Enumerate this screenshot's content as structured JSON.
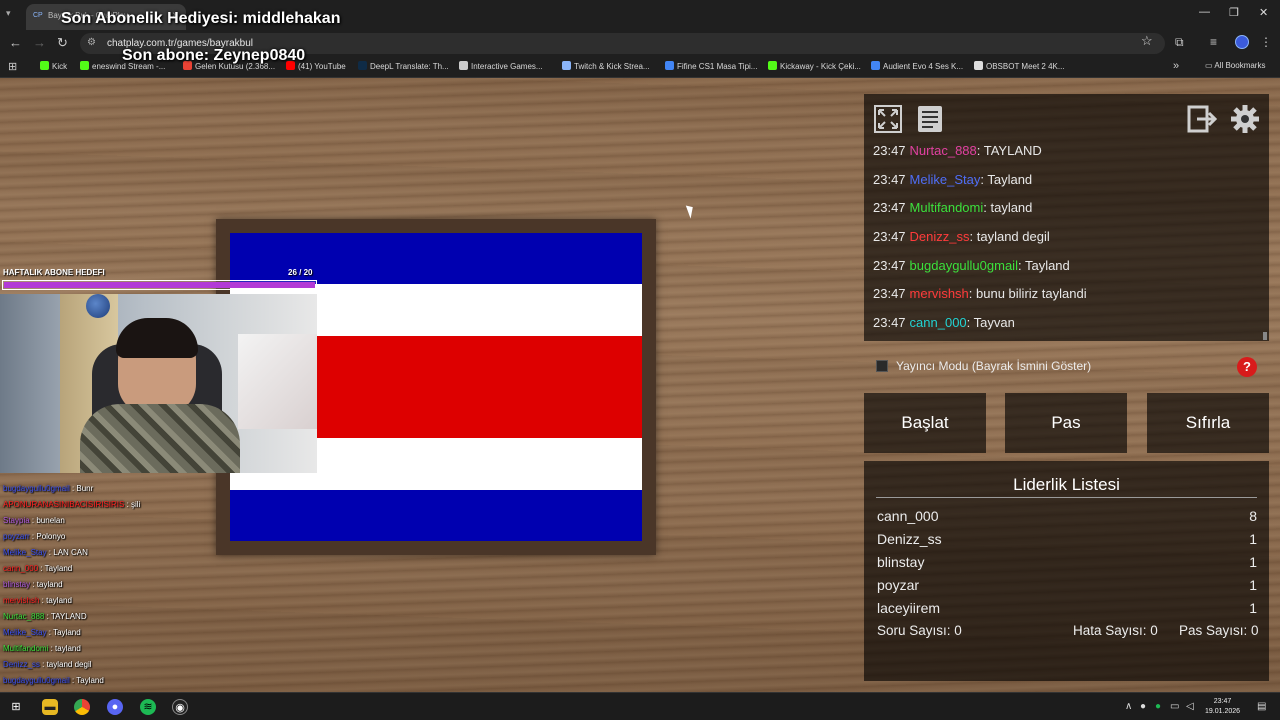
{
  "browser": {
    "tab_title": "Bayrak Bul – ChatPlay",
    "url": "chatplay.com.tr/games/bayrakbul",
    "bookmarks": [
      {
        "label": "Kick",
        "color": "#53fc18"
      },
      {
        "label": "eneswind Stream -...",
        "color": "#53fc18"
      },
      {
        "label": "Gelen Kutusu (2.368...",
        "color": "#ea4335"
      },
      {
        "label": "(41) YouTube",
        "color": "#ff0000"
      },
      {
        "label": "DeepL Translate: Th...",
        "color": "#0f2b46"
      },
      {
        "label": "Interactive Games...",
        "color": "#cccccc"
      },
      {
        "label": "Twitch & Kick Strea...",
        "color": "#8ab4f8"
      },
      {
        "label": "Fifine CS1 Masa Tipi...",
        "color": "#4285f4"
      },
      {
        "label": "Kickaway - Kick Çeki...",
        "color": "#53fc18"
      },
      {
        "label": "Audient Evo 4 Ses K...",
        "color": "#4285f4"
      },
      {
        "label": "OBSBOT Meet 2 4K...",
        "color": "#dddddd"
      }
    ],
    "all_bookmarks": "All Bookmarks"
  },
  "overlay": {
    "latest_gift": "Son Abonelik Hediyesi: middlehakan",
    "latest_sub": "Son abone: Zeynep0840",
    "goal_label": "HAFTALIK ABONE HEDEFI",
    "goal_count": "26  / 20",
    "goal_progress": 1.0
  },
  "game": {
    "flag_stripes": [
      {
        "color": "#0000b0",
        "weight": 1
      },
      {
        "color": "#ffffff",
        "weight": 1
      },
      {
        "color": "#dd0000",
        "weight": 2
      },
      {
        "color": "#ffffff",
        "weight": 1
      },
      {
        "color": "#0000b0",
        "weight": 1
      }
    ],
    "chat": [
      {
        "time": "23:47",
        "user": "Nurtac_888",
        "color": "#e040a0",
        "message": ": TAYLAND"
      },
      {
        "time": "23:47",
        "user": "Melike_Stay",
        "color": "#4f6ef7",
        "message": ": Tayland"
      },
      {
        "time": "23:47",
        "user": "Multifandomi",
        "color": "#3ce03c",
        "message": ": tayland"
      },
      {
        "time": "23:47",
        "user": "Denizz_ss",
        "color": "#ff3b3b",
        "message": ": tayland degil"
      },
      {
        "time": "23:47",
        "user": "bugdaygullu0gmail",
        "color": "#3ce03c",
        "message": ": Tayland"
      },
      {
        "time": "23:47",
        "user": "mervishsh",
        "color": "#ff3b3b",
        "message": ": bunu biliriz taylandi"
      },
      {
        "time": "23:47",
        "user": "cann_000",
        "color": "#22d3d3",
        "message": ": Tayvan"
      }
    ],
    "streamer_mode_label": "Yayıncı Modu (Bayrak İsmini Göster)",
    "help_label": "?",
    "buttons": {
      "start": "Başlat",
      "pass": "Pas",
      "reset": "Sıfırla"
    },
    "leaderboard_title": "Liderlik Listesi",
    "leaderboard": [
      {
        "name": "cann_000",
        "score": "8"
      },
      {
        "name": "Denizz_ss",
        "score": "1"
      },
      {
        "name": "blinstay",
        "score": "1"
      },
      {
        "name": "poyzar",
        "score": "1"
      },
      {
        "name": "laceyiirem",
        "score": "1"
      }
    ],
    "stats": {
      "questions": "Soru Sayısı: 0",
      "errors": "Hata Sayısı: 0",
      "passes": "Pas Sayısı: 0"
    }
  },
  "stream_chat": [
    {
      "user": "bugdaygullu0gmail",
      "color": "#3a4ff0",
      "message": " : Bunr"
    },
    {
      "user": "APONURANASINIBACISIRISIRIS",
      "color": "#ff2020",
      "message": " : şili"
    },
    {
      "user": "Staypia",
      "color": "#b05be0",
      "message": " : bunelan"
    },
    {
      "user": "poyzarr",
      "color": "#3a4ff0",
      "message": " : Polonyo"
    },
    {
      "user": "Melike_Stay",
      "color": "#3a4ff0",
      "message": " : LAN CAN"
    },
    {
      "user": "cann_000",
      "color": "#ff2020",
      "message": " : Tayland"
    },
    {
      "user": "blinstay",
      "color": "#b05be0",
      "message": " : tayland"
    },
    {
      "user": "mervishsh",
      "color": "#ff2020",
      "message": " : tayland"
    },
    {
      "user": "Nurtac_888",
      "color": "#3ce03c",
      "message": " : TAYLAND"
    },
    {
      "user": "Melike_Stay",
      "color": "#3a4ff0",
      "message": " : Tayland"
    },
    {
      "user": "Multifandomi",
      "color": "#3ce03c",
      "message": " : tayland"
    },
    {
      "user": "Denizz_ss",
      "color": "#3a4ff0",
      "message": " : tayland degil"
    },
    {
      "user": "bugdaygullu0gmail",
      "color": "#3a4ff0",
      "message": " : Tayland"
    },
    {
      "user": "mervishsh",
      "color": "#ff2020",
      "message": " : bunu biliriz taylandi"
    },
    {
      "user": "cann_000",
      "color": "#ff2020",
      "message": " : Tayvan"
    }
  ],
  "taskbar": {
    "time": "23:47",
    "date": "19.01.2026"
  }
}
